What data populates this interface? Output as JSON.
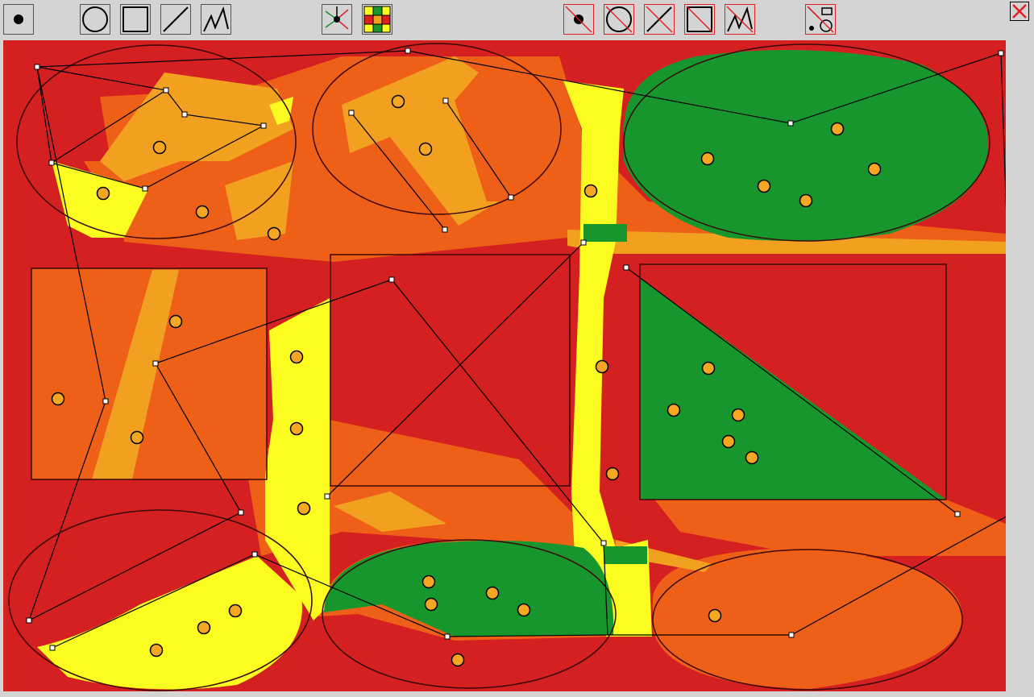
{
  "colors": {
    "background": "#d4d4d4",
    "class_red": "#d42020",
    "class_orange": "#ee6018",
    "class_amber": "#f2a020",
    "class_yellow": "#fcfc20",
    "class_green": "#18962e",
    "delete_tool_border": "#e02020",
    "point_fill": "#f5a623"
  },
  "toolbar": {
    "draw_tools": [
      {
        "name": "point-tool",
        "icon": "point-icon"
      },
      {
        "name": "circle-tool",
        "icon": "circle-icon"
      },
      {
        "name": "rectangle-tool",
        "icon": "square-icon"
      },
      {
        "name": "line-tool",
        "icon": "line-icon"
      },
      {
        "name": "polyline-tool",
        "icon": "polyline-icon"
      }
    ],
    "analysis_tools": [
      {
        "name": "nearest-neighbor-tool",
        "icon": "nearest-neighbor-icon"
      },
      {
        "name": "color-grid-tool",
        "icon": "color-grid-icon"
      }
    ],
    "delete_tools": [
      {
        "name": "delete-point-tool",
        "icon": "crossed-point-icon"
      },
      {
        "name": "delete-circle-tool",
        "icon": "crossed-circle-icon"
      },
      {
        "name": "delete-line-tool",
        "icon": "crossed-line-icon"
      },
      {
        "name": "delete-rectangle-tool",
        "icon": "crossed-square-icon"
      },
      {
        "name": "delete-polyline-tool",
        "icon": "crossed-polyline-icon"
      }
    ],
    "clear_tool": {
      "name": "clear-all-tool",
      "icon": "clear-shapes-icon"
    },
    "close": {
      "name": "close-button",
      "icon": "close-icon"
    }
  }
}
